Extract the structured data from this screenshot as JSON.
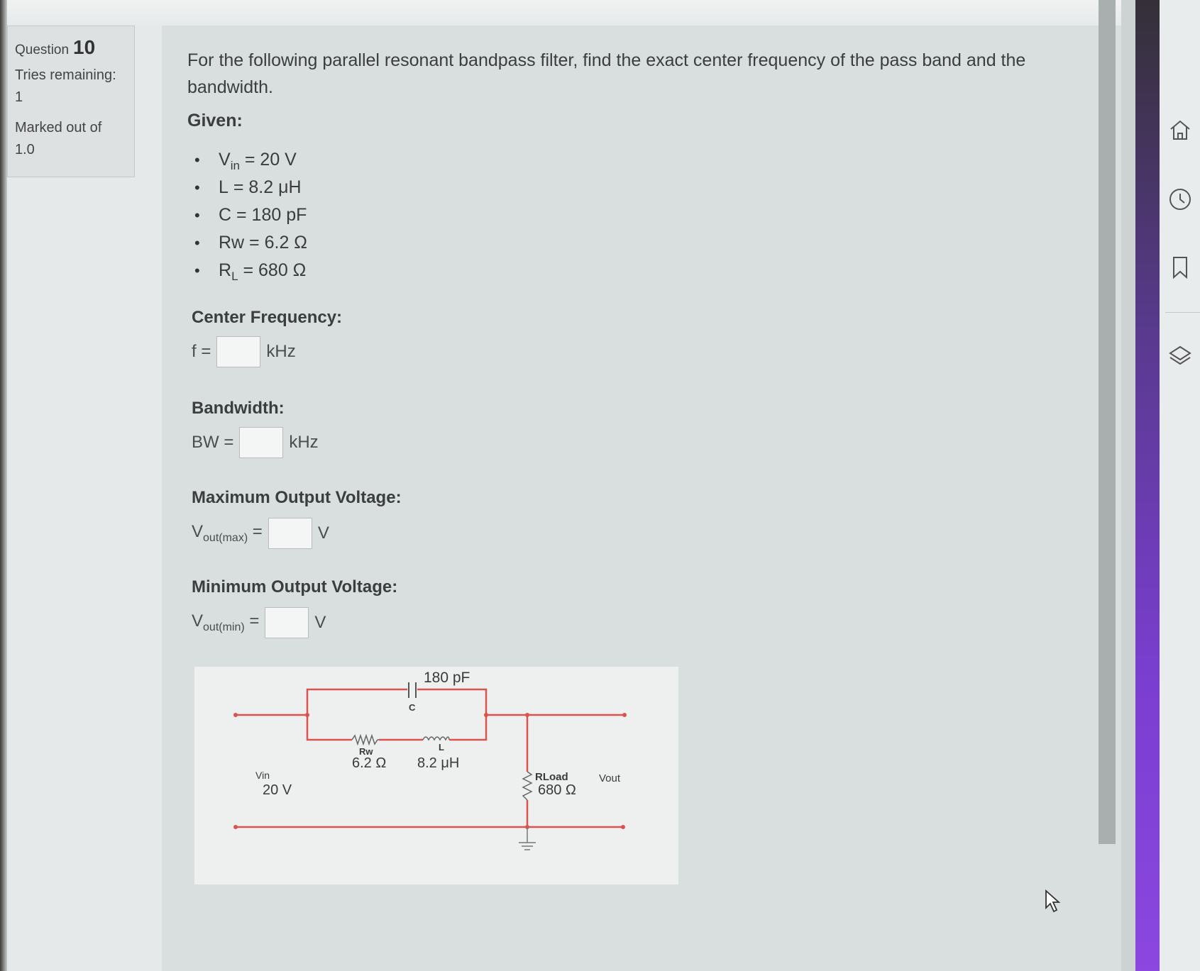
{
  "question": {
    "label": "Question",
    "number": "10",
    "tries_label": "Tries remaining:",
    "tries_value": "1",
    "marked_label": "Marked out of",
    "marked_value": "1.0"
  },
  "text": "For the following parallel resonant bandpass filter, find the exact center frequency of the pass band and the bandwidth.",
  "given_title": "Given:",
  "given": [
    {
      "sym": "V",
      "sub": "in",
      "rest": " = 20 V"
    },
    {
      "sym": "L",
      "sub": "",
      "rest": " = 8.2 μH"
    },
    {
      "sym": "C",
      "sub": "",
      "rest": " = 180 pF"
    },
    {
      "sym": "Rw",
      "sub": "",
      "rest": " = 6.2 Ω"
    },
    {
      "sym": "R",
      "sub": "L",
      "rest": " = 680 Ω"
    }
  ],
  "sections": {
    "center": {
      "title": "Center Frequency:",
      "prefix": "f =",
      "unit": "kHz"
    },
    "bandwidth": {
      "title": "Bandwidth:",
      "prefix": "BW =",
      "unit": "kHz"
    },
    "vmax": {
      "title": "Maximum Output Voltage:",
      "prefix_main": "V",
      "prefix_sub": "out(max)",
      "prefix_end": " =",
      "unit": "V"
    },
    "vmin": {
      "title": "Minimum Output Voltage:",
      "prefix_main": "V",
      "prefix_sub": "out(min)",
      "prefix_end": " =",
      "unit": "V"
    }
  },
  "circuit": {
    "cap_value": "180 pF",
    "cap_label": "C",
    "rw_label": "Rw",
    "rw_value": "6.2 Ω",
    "l_label": "L",
    "l_value": "8.2 μH",
    "vin_label": "Vin",
    "vin_value": "20 V",
    "rload_label": "RLoad",
    "rload_value": "680 Ω",
    "vout_label": "Vout",
    "wire_color": "#d9534f"
  },
  "sidebar_icons": [
    "home-icon",
    "clock-icon",
    "bookmark-icon",
    "layers-icon"
  ]
}
